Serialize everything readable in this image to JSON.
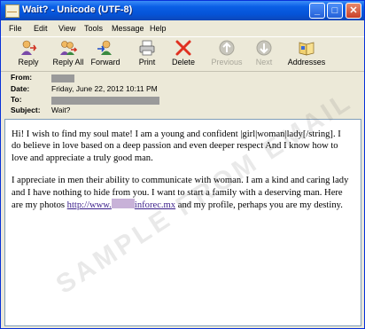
{
  "window": {
    "title": "Wait? - Unicode (UTF-8)",
    "controls": {
      "minimize": "_",
      "maximize": "□",
      "close": "✕"
    }
  },
  "menu": {
    "file": "File",
    "edit": "Edit",
    "view": "View",
    "tools": "Tools",
    "message": "Message",
    "help": "Help"
  },
  "toolbar": {
    "reply": "Reply",
    "reply_all": "Reply All",
    "forward": "Forward",
    "print": "Print",
    "delete": "Delete",
    "previous": "Previous",
    "next": "Next",
    "addresses": "Addresses"
  },
  "headers": {
    "from_label": "From:",
    "date_label": "Date:",
    "date_value": "Friday, June 22, 2012 10:11 PM",
    "to_label": "To:",
    "subject_label": "Subject:",
    "subject_value": "Wait?"
  },
  "body": {
    "p1": "Hi! I wish to find my soul mate! I am a young and confident |girl|woman|lady[/string]. I do believe in love based on a deep passion and even deeper respect And I know how to love and appreciate a truly good man.",
    "p2_before": "I appreciate in men their ability to communicate with woman. I am a kind and caring lady and I have nothing to hide from you. I want to start a family with a deserving man. Here are my photos ",
    "link_start": "http://www.",
    "link_end": "inforec.mx",
    "p2_after": " and my profile, perhaps you are my destiny."
  },
  "watermark": "SAMPLE FROM EMAIL",
  "colors": {
    "titlebar": "#0553d6",
    "link": "#3a1e8a",
    "delete_x": "#e03020"
  }
}
